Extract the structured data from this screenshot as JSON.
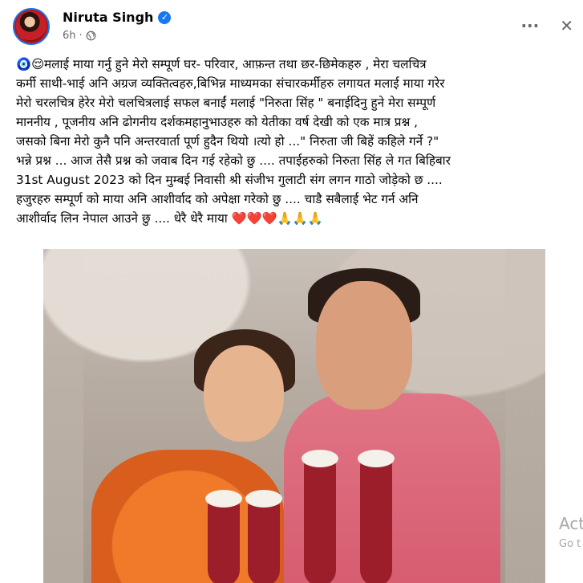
{
  "post": {
    "author": "Niruta Singh",
    "time": "6h",
    "separator": "·",
    "caption_lines": [
      "🧿😌मलाई माया गर्नु हुने मेरो सम्पूर्ण  घर- परिवार, आफ़न्त तथा छर-छिमेकहरु , मेरा चलचित्र",
      "कर्मी साथी-भाई अनि अग्रज व्यक्तित्वहरु,बिभिन्न माध्यमका संचारकर्मीहरु लगायत मलाई माया गरेर",
      "मेरो चरलचित्र हेरेर  मेरो चलचित्रलाई सफल बनाईं मलाई \"निरुता सिंह \" बनाईदिनु हुने मेरा सम्पूर्ण",
      "माननीय , पूजनीय अनि ढोगनीय दर्शकमहानुभाउहरु को येतीका वर्ष देखी को  एक मात्र प्रश्न ,",
      "जसको बिना  मेरो कुनै पनि अन्तरवार्ता पूर्ण हुदैन थियो ।त्यो हो ...\" निरुता जी बिहें कहिले गर्ने  ?\"",
      "भन्ने प्रश्न ... आज तेसै प्रश्न को जवाब दिन गई रहेको छु .... तपाईहरुको निरुता सिंह ले गत बिहिबार",
      "31st August 2023  को दिन  मुम्बई निवासी श्री संजीभ गुलाटी संग लगन गाठो जोड़ेको छ ....",
      "हजुरहरु सम्पूर्ण को माया अनि आशीर्वाद को अपेक्षा गरेको छु .... चाडै सबैलाई भेट गर्न अनि",
      "आशीर्वाद लिन नेपाल आउने छु .... धेरै धेरै  माया ❤️❤️❤️🙏🙏🙏"
    ],
    "more_label": "···",
    "close_label": "✕"
  },
  "watermark": {
    "line1": "Act",
    "line2": "Go t"
  },
  "icons": [
    "globe-icon",
    "verified-icon",
    "more-icon",
    "close-icon"
  ],
  "colors": {
    "accent": "#1877f2",
    "meta": "#65676b"
  }
}
